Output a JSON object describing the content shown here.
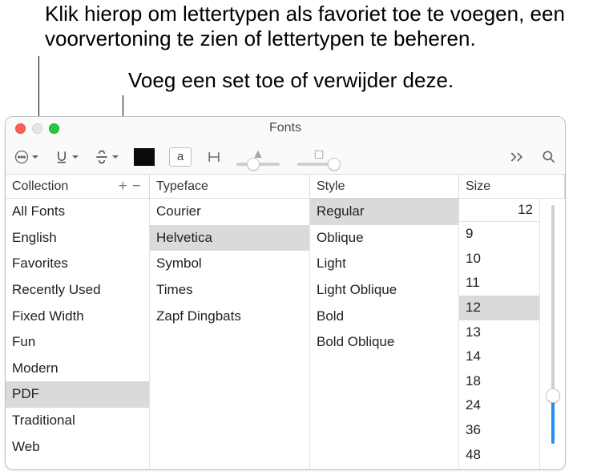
{
  "callouts": {
    "more_menu": "Klik hierop om lettertypen als favoriet toe te voegen, een voorvertoning te zien of lettertypen te beheren.",
    "add_remove": "Voeg een set toe of verwijder deze."
  },
  "window": {
    "title": "Fonts"
  },
  "toolbar": {
    "more_icon": "more-icon",
    "underline": "underline-icon",
    "strikethrough": "strikethrough-icon",
    "text_color_sample": "a",
    "shadow_indicator": "▲",
    "blur_indicator": "◻",
    "shadow_slider": 0.38,
    "blur_slider": 0.85
  },
  "columns": {
    "collection": "Collection",
    "typeface": "Typeface",
    "style": "Style",
    "size": "Size",
    "add": "+",
    "remove": "−"
  },
  "collections": {
    "items": [
      "All Fonts",
      "English",
      "Favorites",
      "Recently Used",
      "Fixed Width",
      "Fun",
      "Modern",
      "PDF",
      "Traditional",
      "Web"
    ],
    "selected": "PDF"
  },
  "typefaces": {
    "items": [
      "Courier",
      "Helvetica",
      "Symbol",
      "Times",
      "Zapf Dingbats"
    ],
    "selected": "Helvetica"
  },
  "styles": {
    "items": [
      "Regular",
      "Oblique",
      "Light",
      "Light Oblique",
      "Bold",
      "Bold Oblique"
    ],
    "selected": "Regular"
  },
  "size": {
    "current": "12",
    "options": [
      "9",
      "10",
      "11",
      "12",
      "13",
      "14",
      "18",
      "24",
      "36",
      "48"
    ],
    "selected": "12",
    "slider_position": 0.82
  }
}
